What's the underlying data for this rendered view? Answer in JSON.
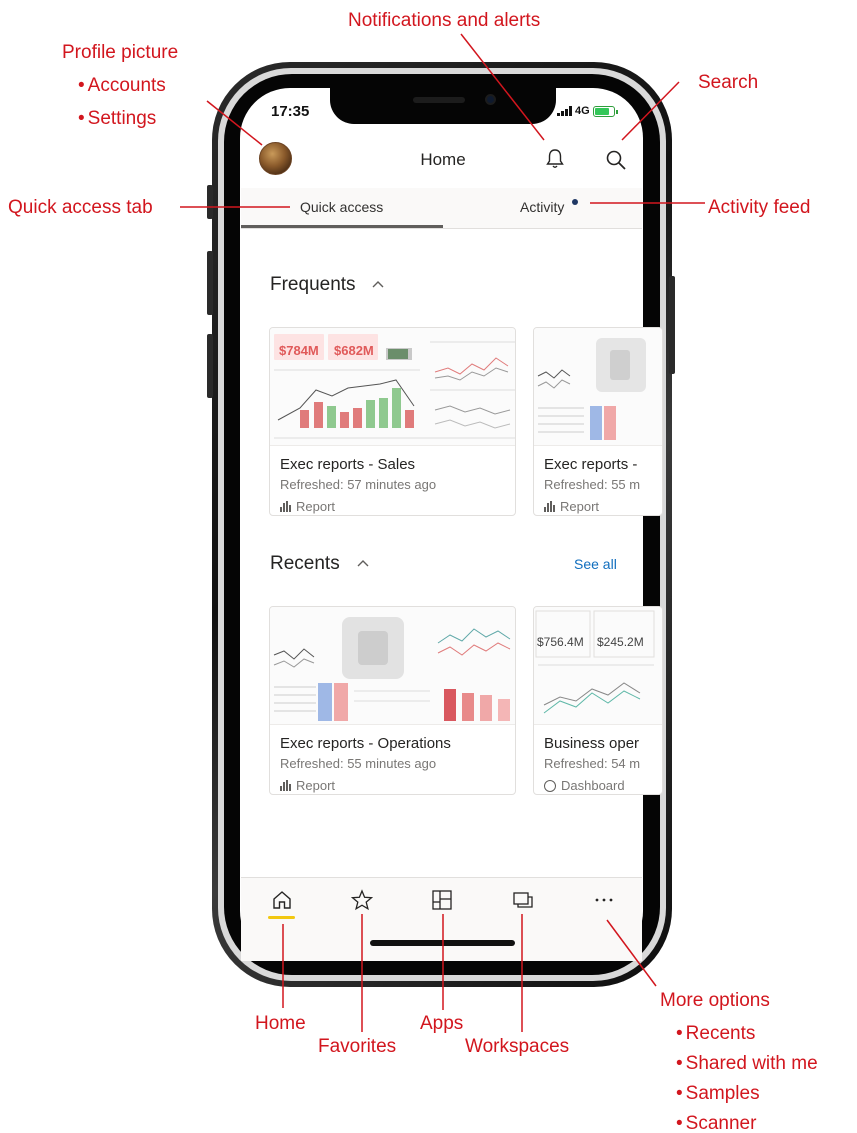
{
  "status_bar": {
    "time": "17:35",
    "network": "4G"
  },
  "header": {
    "title": "Home",
    "avatar_icon": "avatar",
    "bell_icon": "bell-icon",
    "search_icon": "search-icon"
  },
  "tabs": [
    {
      "label": "Quick access",
      "selected": true
    },
    {
      "label": "Activity",
      "selected": false,
      "has_new_indicator": true
    }
  ],
  "frequents": {
    "title": "Frequents",
    "cards": [
      {
        "title": "Exec reports - Sales",
        "subtitle": "Refreshed: 57 minutes ago",
        "type": "Report",
        "thumb_kpis": [
          "$784M",
          "$682M"
        ]
      },
      {
        "title": "Exec reports -",
        "subtitle": "Refreshed: 55 m",
        "type": "Report"
      }
    ]
  },
  "recents": {
    "title": "Recents",
    "see_all": "See all",
    "cards": [
      {
        "title": "Exec reports - Operations",
        "subtitle": "Refreshed: 55 minutes ago",
        "type": "Report"
      },
      {
        "title": "Business oper",
        "subtitle": "Refreshed: 54 m",
        "type": "Dashboard",
        "thumb_kpis": [
          "$756.4M",
          "$245.2M"
        ]
      }
    ]
  },
  "bottom_nav": [
    {
      "name": "home",
      "icon": "home-icon",
      "active": true
    },
    {
      "name": "favorites",
      "icon": "star-icon",
      "active": false
    },
    {
      "name": "apps",
      "icon": "apps-icon",
      "active": false
    },
    {
      "name": "workspaces",
      "icon": "workspaces-icon",
      "active": false
    },
    {
      "name": "more",
      "icon": "more-icon",
      "active": false
    }
  ],
  "callouts": {
    "profile": "Profile picture",
    "accounts": "Accounts",
    "settings": "Settings",
    "notifications": "Notifications and alerts",
    "search": "Search",
    "quick_access": "Quick access tab",
    "activity_feed": "Activity feed",
    "home": "Home",
    "favorites": "Favorites",
    "apps": "Apps",
    "workspaces": "Workspaces",
    "more_options": "More options",
    "more_recents": "Recents",
    "more_shared": "Shared with me",
    "more_samples": "Samples",
    "more_scanner": "Scanner"
  },
  "colors": {
    "callout": "#d2161e",
    "accent_yellow": "#f2c811",
    "link": "#106ebe",
    "activity_dot": "#1f3864"
  }
}
